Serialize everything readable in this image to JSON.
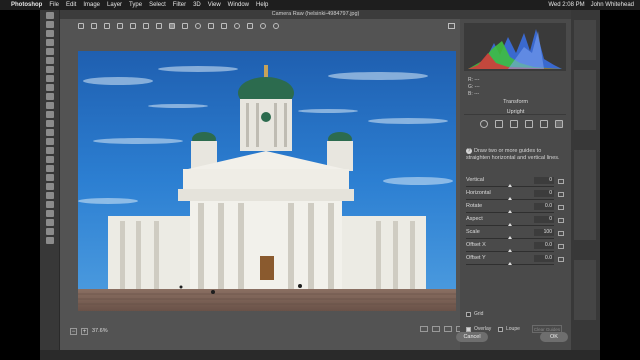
{
  "menubar": {
    "app": "Photoshop",
    "items": [
      "File",
      "Edit",
      "Image",
      "Layer",
      "Type",
      "Select",
      "Filter",
      "3D",
      "View",
      "Window",
      "Help"
    ],
    "clock": "Wed 2:08 PM",
    "user": "John Whitehead"
  },
  "dialog": {
    "title": "Camera Raw (helsinki-4984797.jpg)",
    "zoom": "37.6%",
    "panel": {
      "histogram_info": [
        "R: ---",
        "G: ---",
        "B: ---"
      ],
      "section_title": "Transform",
      "upright_title": "Upright",
      "help_text": "Draw two or more guides to straighten horizontal and vertical lines.",
      "sliders": [
        {
          "label": "Vertical",
          "value": "0",
          "pos": 0.5
        },
        {
          "label": "Horizontal",
          "value": "0",
          "pos": 0.5
        },
        {
          "label": "Rotate",
          "value": "0.0",
          "pos": 0.5
        },
        {
          "label": "Aspect",
          "value": "0",
          "pos": 0.5
        },
        {
          "label": "Scale",
          "value": "100",
          "pos": 0.5
        },
        {
          "label": "Offset X",
          "value": "0.0",
          "pos": 0.5
        },
        {
          "label": "Offset Y",
          "value": "0.0",
          "pos": 0.5
        }
      ],
      "grid_label": "Grid",
      "overlay_label": "Overlay",
      "loupe_label": "Loupe",
      "clear_guides_label": "Clear Guides",
      "overlay_checked": true,
      "loupe_checked": false
    },
    "cancel_label": "Cancel",
    "ok_label": "OK"
  }
}
